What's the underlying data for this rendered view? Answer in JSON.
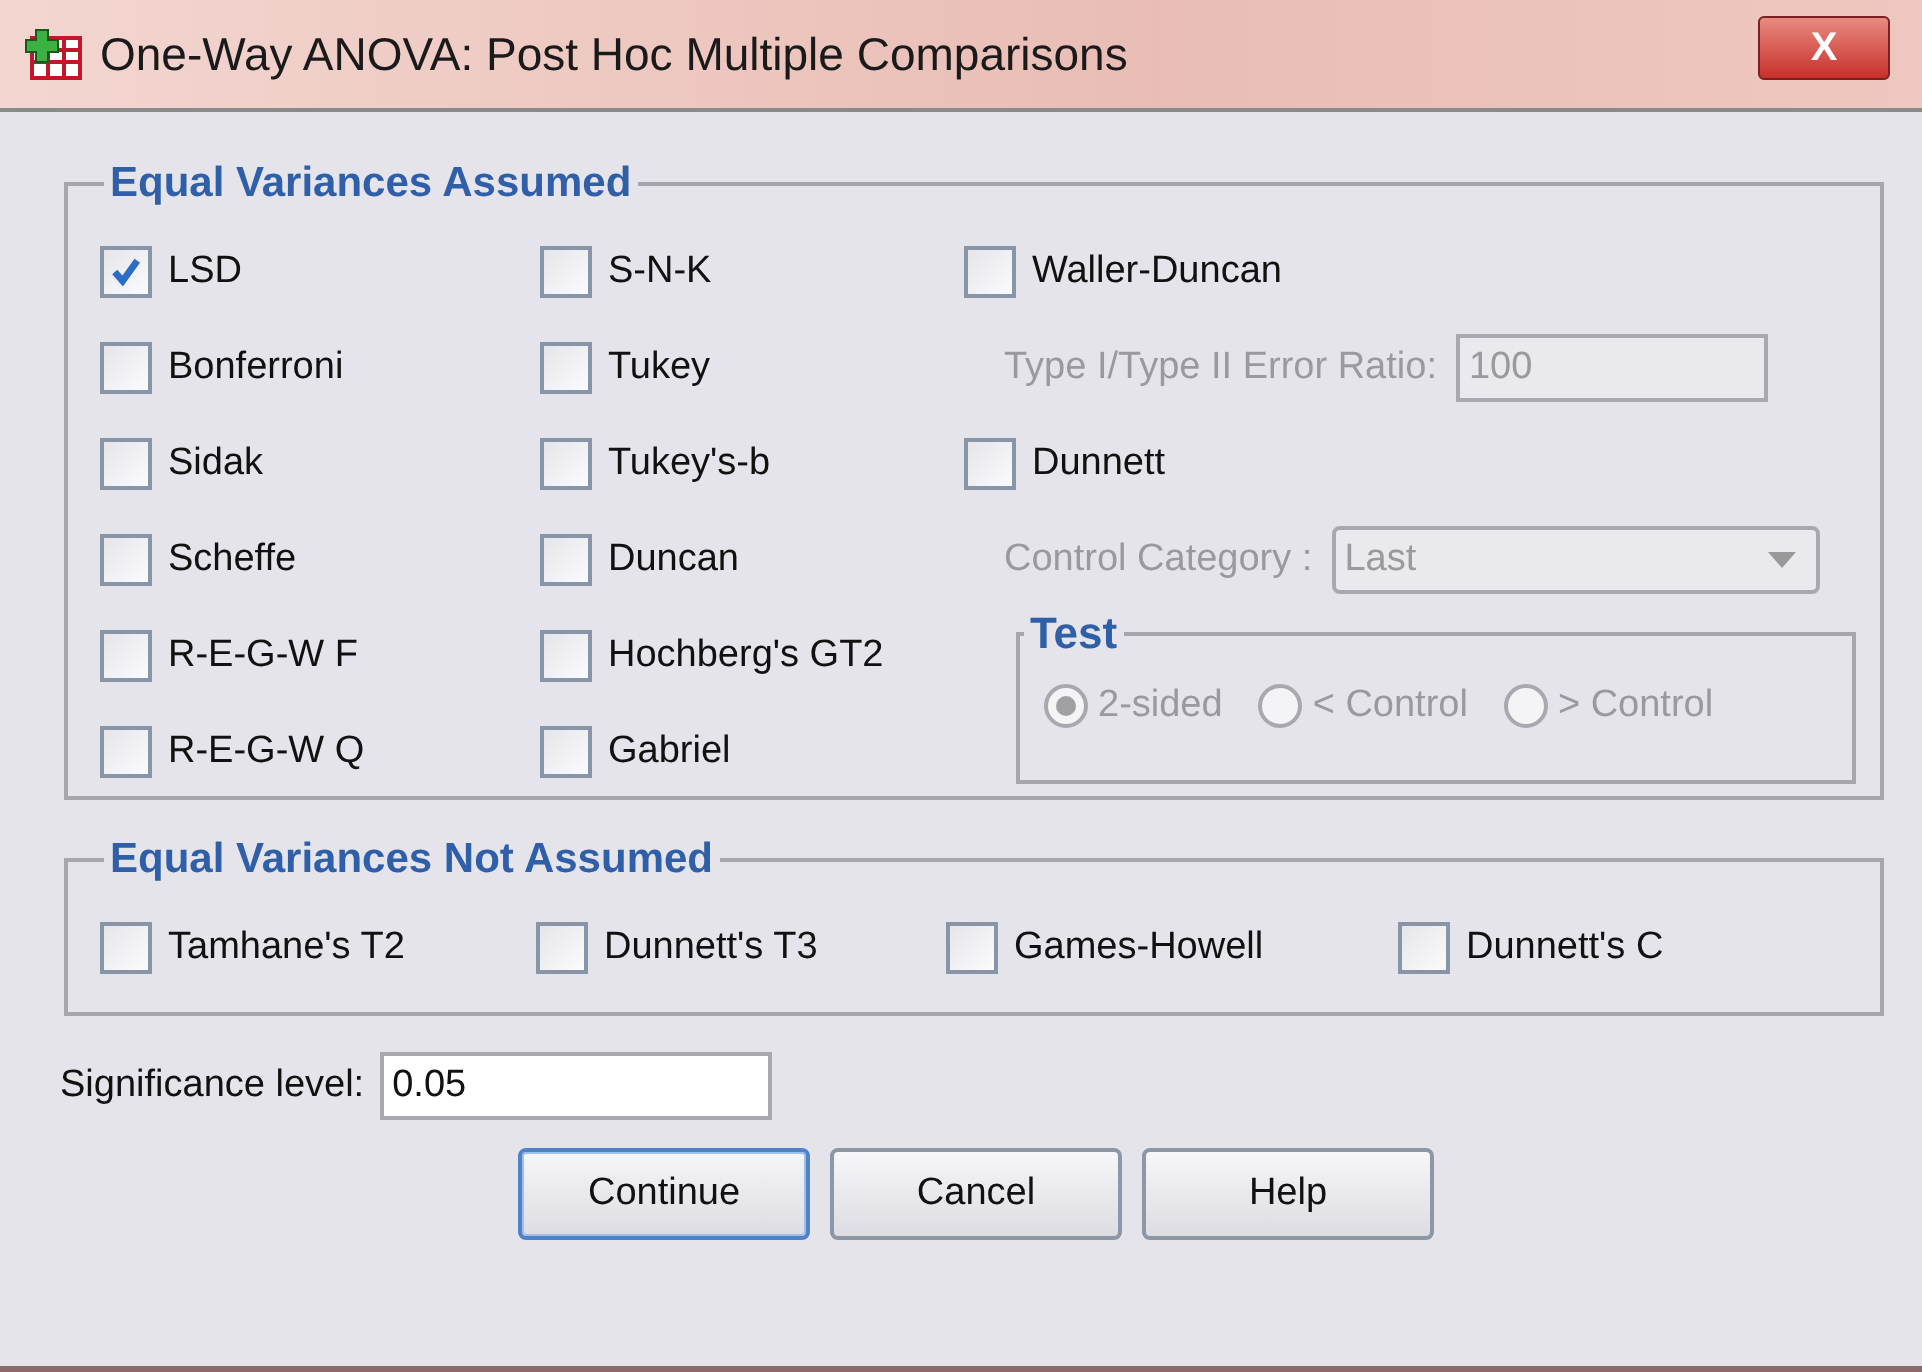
{
  "window": {
    "title": "One-Way ANOVA: Post Hoc Multiple Comparisons",
    "close": "X"
  },
  "equal_variances_assumed": {
    "title": "Equal Variances Assumed",
    "column_1": [
      {
        "label": "LSD",
        "checked": true
      },
      {
        "label": "Bonferroni",
        "checked": false
      },
      {
        "label": "Sidak",
        "checked": false
      },
      {
        "label": "Scheffe",
        "checked": false
      },
      {
        "label": "R-E-G-W F",
        "checked": false
      },
      {
        "label": "R-E-G-W Q",
        "checked": false
      }
    ],
    "column_2": [
      {
        "label": "S-N-K",
        "checked": false
      },
      {
        "label": "Tukey",
        "checked": false
      },
      {
        "label": "Tukey's-b",
        "checked": false
      },
      {
        "label": "Duncan",
        "checked": false
      },
      {
        "label": "Hochberg's GT2",
        "checked": false
      },
      {
        "label": "Gabriel",
        "checked": false
      }
    ],
    "waller_duncan": {
      "label": "Waller-Duncan",
      "checked": false,
      "ratio_label": "Type I/Type II Error Ratio:",
      "ratio_value": "100",
      "disabled": true
    },
    "dunnett": {
      "label": "Dunnett",
      "checked": false,
      "control_category_label": "Control Category :",
      "control_category_value": "Last",
      "disabled": true
    },
    "test": {
      "title": "Test",
      "disabled": true,
      "options": [
        {
          "label": "2-sided",
          "selected": true
        },
        {
          "label": "< Control",
          "selected": false
        },
        {
          "label": "> Control",
          "selected": false
        }
      ]
    }
  },
  "equal_variances_not_assumed": {
    "title": "Equal Variances Not Assumed",
    "options": [
      {
        "label": "Tamhane's T2",
        "checked": false
      },
      {
        "label": "Dunnett's T3",
        "checked": false
      },
      {
        "label": "Games-Howell",
        "checked": false
      },
      {
        "label": "Dunnett's C",
        "checked": false
      }
    ]
  },
  "significance_level": {
    "label": "Significance level:",
    "value": "0.05"
  },
  "buttons": [
    "Continue",
    "Cancel",
    "Help"
  ]
}
